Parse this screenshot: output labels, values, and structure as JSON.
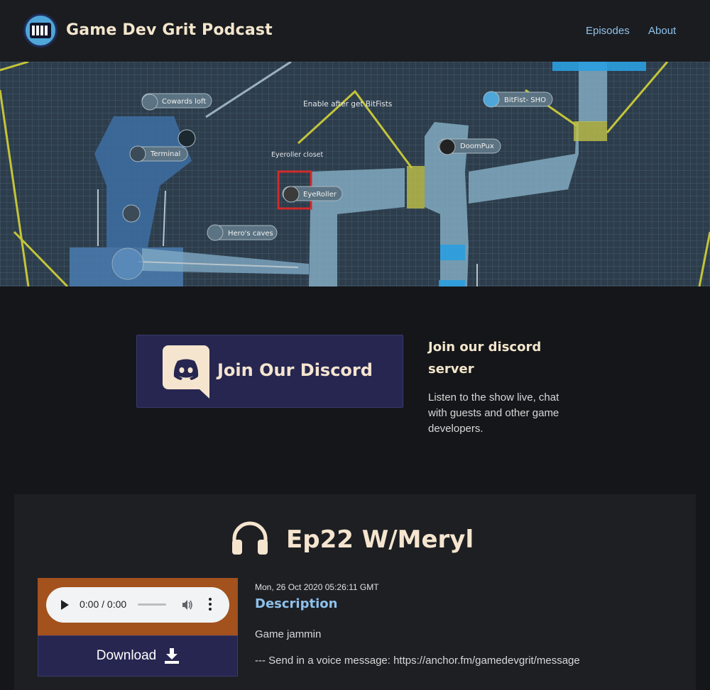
{
  "header": {
    "site_title": "Game Dev Grit Podcast",
    "nav": [
      {
        "label": "Episodes"
      },
      {
        "label": "About"
      }
    ]
  },
  "hero": {
    "map_labels": {
      "cowards_loft": "Cowards loft",
      "enable_note": "Enable after get BitFists",
      "bitfist": "BitFist- SHO",
      "terminal": "Terminal",
      "eyeroller_closet": "Eyeroller closet",
      "doompux": "DoomPux",
      "eyeroller": "EyeRoller",
      "heros_caves": "Hero's caves"
    }
  },
  "discord": {
    "button_label": "Join Our Discord",
    "heading": "Join our discord server",
    "text": "Listen to the show live, chat with guests and other game developers."
  },
  "episode": {
    "title": "Ep22 W/Meryl",
    "date": "Mon, 26 Oct 2020 05:26:11 GMT",
    "description_heading": "Description",
    "description_p1": "Game jammin",
    "description_p2": "--- Send in a voice message: https://anchor.fm/gamedevgrit/message",
    "player": {
      "time": "0:00 / 0:00"
    },
    "download_label": "Download"
  },
  "colors": {
    "page_bg": "#151619",
    "nav_bg": "#1b1c20",
    "accent_blue": "#8ec1ea",
    "cream": "#f5e5cf",
    "discord_bg": "#262650",
    "player_bg": "#a3511d"
  }
}
